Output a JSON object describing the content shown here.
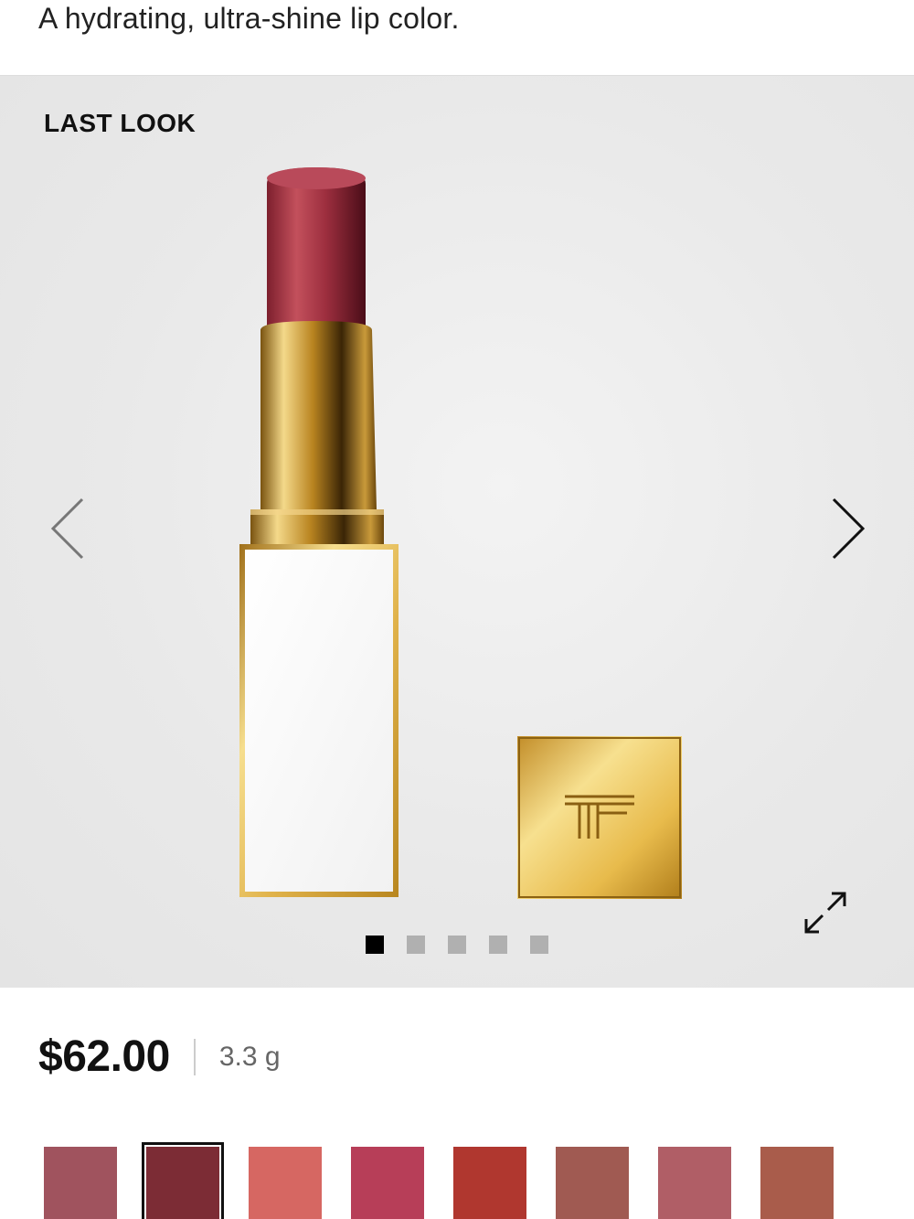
{
  "product": {
    "tagline": "A hydrating, ultra-shine lip color.",
    "shade_name": "LAST LOOK",
    "price": "$62.00",
    "size": "3.3 g"
  },
  "gallery": {
    "slide_count": 5,
    "active_index": 0,
    "prev_icon": "chevron-left-icon",
    "next_icon": "chevron-right-icon",
    "expand_icon": "expand-icon"
  },
  "swatches": [
    {
      "color": "#a0535e",
      "selected": false
    },
    {
      "color": "#7c2c35",
      "selected": true
    },
    {
      "color": "#d66762",
      "selected": false
    },
    {
      "color": "#b73e58",
      "selected": false
    },
    {
      "color": "#b0372f",
      "selected": false
    },
    {
      "color": "#a05a52",
      "selected": false
    },
    {
      "color": "#b05e66",
      "selected": false
    },
    {
      "color": "#a95c4b",
      "selected": false
    }
  ],
  "colors": {
    "bullet": "#a63a4a",
    "gold": "#d8a93a"
  }
}
